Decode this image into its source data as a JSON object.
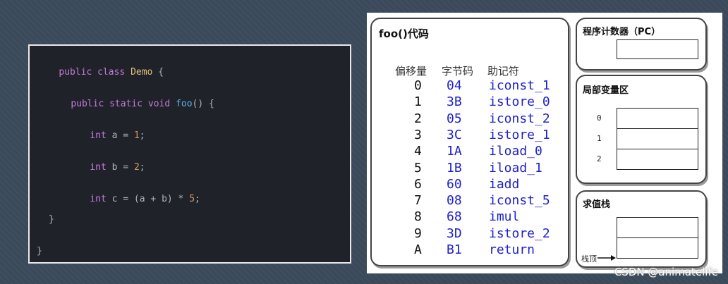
{
  "code": {
    "line1": {
      "kw1": "public",
      "kw2": "class",
      "cls": "Demo",
      "brace": "{"
    },
    "line2": {
      "kw1": "public",
      "kw2": "static",
      "kw3": "void",
      "fn": "foo",
      "rest": "() {"
    },
    "line3": {
      "type": "int",
      "name": "a",
      "eq": "=",
      "num": "1",
      "semi": ";"
    },
    "line4": {
      "type": "int",
      "name": "b",
      "eq": "=",
      "num": "2",
      "semi": ";"
    },
    "line5": {
      "type": "int",
      "name": "c",
      "expr": "= (a + b) *",
      "num": "5",
      "semi": ";"
    },
    "line6": "}",
    "line7": "}"
  },
  "diagram": {
    "code_title": "foo()代码",
    "col_offset": "偏移量",
    "col_bytecode": "字节码",
    "col_mnemonic": "助记符",
    "instructions": [
      {
        "offset": "0",
        "hex": "04",
        "op": "iconst_1"
      },
      {
        "offset": "1",
        "hex": "3B",
        "op": "istore_0"
      },
      {
        "offset": "2",
        "hex": "05",
        "op": "iconst_2"
      },
      {
        "offset": "3",
        "hex": "3C",
        "op": "istore_1"
      },
      {
        "offset": "4",
        "hex": "1A",
        "op": "iload_0"
      },
      {
        "offset": "5",
        "hex": "1B",
        "op": "iload_1"
      },
      {
        "offset": "6",
        "hex": "60",
        "op": "iadd"
      },
      {
        "offset": "7",
        "hex": "08",
        "op": "iconst_5"
      },
      {
        "offset": "8",
        "hex": "68",
        "op": "imul"
      },
      {
        "offset": "9",
        "hex": "3D",
        "op": "istore_2"
      },
      {
        "offset": "A",
        "hex": "B1",
        "op": "return"
      }
    ],
    "pc_title": "程序计数器（PC）",
    "locals_title": "局部变量区",
    "locals_slots": [
      "0",
      "1",
      "2"
    ],
    "stack_title": "求值栈",
    "stack_top_label": "栈顶"
  },
  "watermark": "CSDN @animatelife"
}
